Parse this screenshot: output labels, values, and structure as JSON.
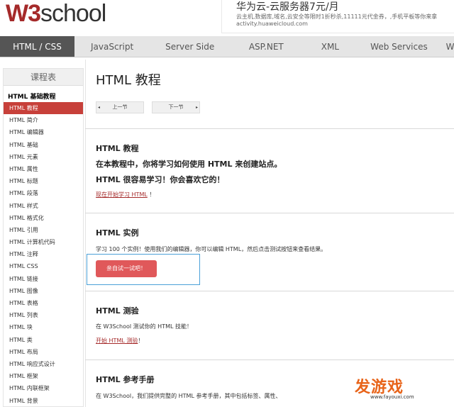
{
  "header": {
    "logo_w3": "W3",
    "logo_school": "school",
    "ad": {
      "title": "华为云-云服务器7元/月",
      "desc": "云主机,数据库,域名,云安全等限时1折秒杀,11111元代金券，,手机平板等你来拿",
      "url": "activity.huaweicloud.com"
    }
  },
  "nav": {
    "items": [
      {
        "label": "HTML / CSS"
      },
      {
        "label": "JavaScript"
      },
      {
        "label": "Server Side"
      },
      {
        "label": "ASP.NET"
      },
      {
        "label": "XML"
      },
      {
        "label": "Web Services"
      },
      {
        "label": "Web"
      }
    ]
  },
  "sidebar": {
    "title": "课程表",
    "section": "HTML 基础教程",
    "items": [
      "HTML 教程",
      "HTML 简介",
      "HTML 编辑器",
      "HTML 基础",
      "HTML 元素",
      "HTML 属性",
      "HTML 标题",
      "HTML 段落",
      "HTML 样式",
      "HTML 格式化",
      "HTML 引用",
      "HTML 计算机代码",
      "HTML 注释",
      "HTML CSS",
      "HTML 链接",
      "HTML 图像",
      "HTML 表格",
      "HTML 列表",
      "HTML 块",
      "HTML 类",
      "HTML 布局",
      "HTML 响应式设计",
      "HTML 框架",
      "HTML 内联框架",
      "HTML 背景"
    ]
  },
  "main": {
    "title": "HTML 教程",
    "prev": "上一节",
    "next": "下一节",
    "s1": {
      "heading": "HTML 教程",
      "line1": "在本教程中，你将学习如何使用 HTML 来创建站点。",
      "line2": "HTML 很容易学习！你会喜欢它的！",
      "link": "现在开始学习 HTML",
      "link_suffix": " ！"
    },
    "s2": {
      "heading": "HTML 实例",
      "text": "学习 100 个实例！使用我们的编辑器，你可以编辑 HTML，然后点击测试按钮来查看结果。",
      "button": "亲自试一试吧！"
    },
    "s3": {
      "heading": "HTML 测验",
      "text": "在 W3School 测试你的 HTML 技能！",
      "link": "开始 HTML 测验",
      "link_suffix": "！"
    },
    "s4": {
      "heading": "HTML 参考手册",
      "text": "在 W3School，我们提供完整的 HTML 参考手册，其中包括标签、属性、"
    }
  },
  "watermark": {
    "logo": "发游戏",
    "url": "www.fayouxi.com"
  },
  "colors": {
    "accent": "#c7403a",
    "nav_active": "#555555",
    "link": "#a52a2a",
    "button": "#e0585a",
    "highlight_frame": "#4aa0d8"
  }
}
